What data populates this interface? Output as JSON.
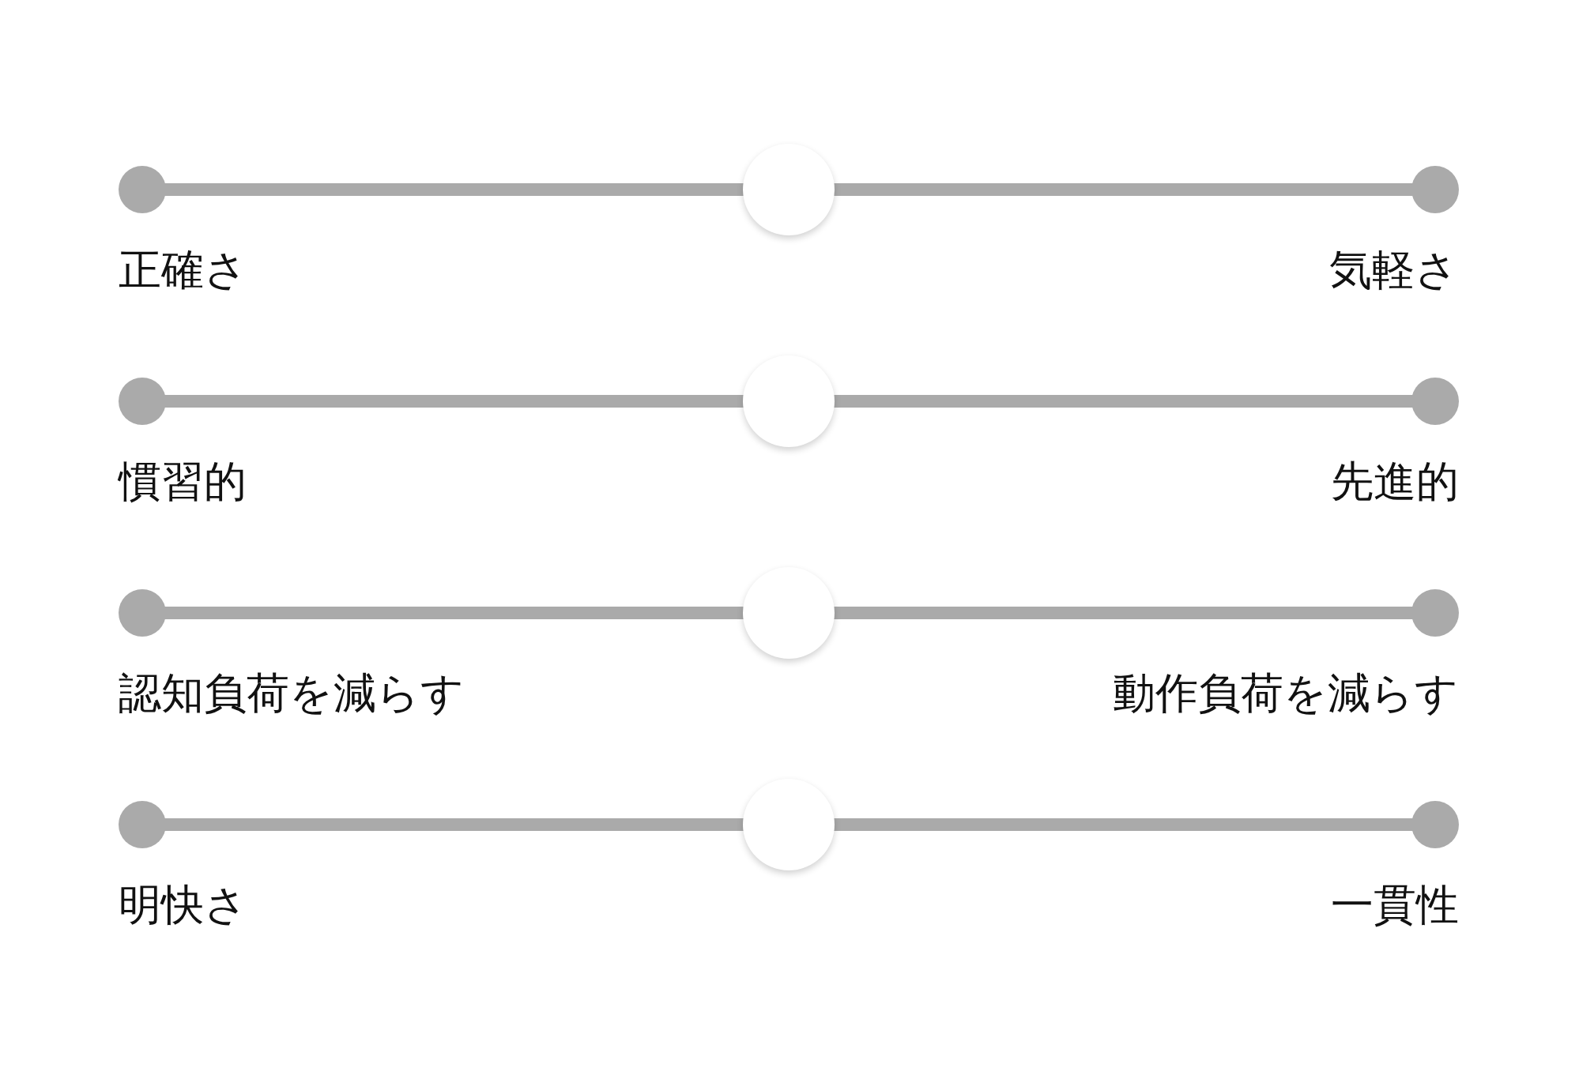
{
  "sliders": [
    {
      "left_label": "正確さ",
      "right_label": "気軽さ",
      "level": 0.5
    },
    {
      "left_label": "慣習的",
      "right_label": "先進的",
      "level": 0.5
    },
    {
      "left_label": "認知負荷を減らす",
      "right_label": "動作負荷を減らす",
      "level": 0.5
    },
    {
      "left_label": "明快さ",
      "right_label": "一貫性",
      "level": 0.5
    }
  ]
}
